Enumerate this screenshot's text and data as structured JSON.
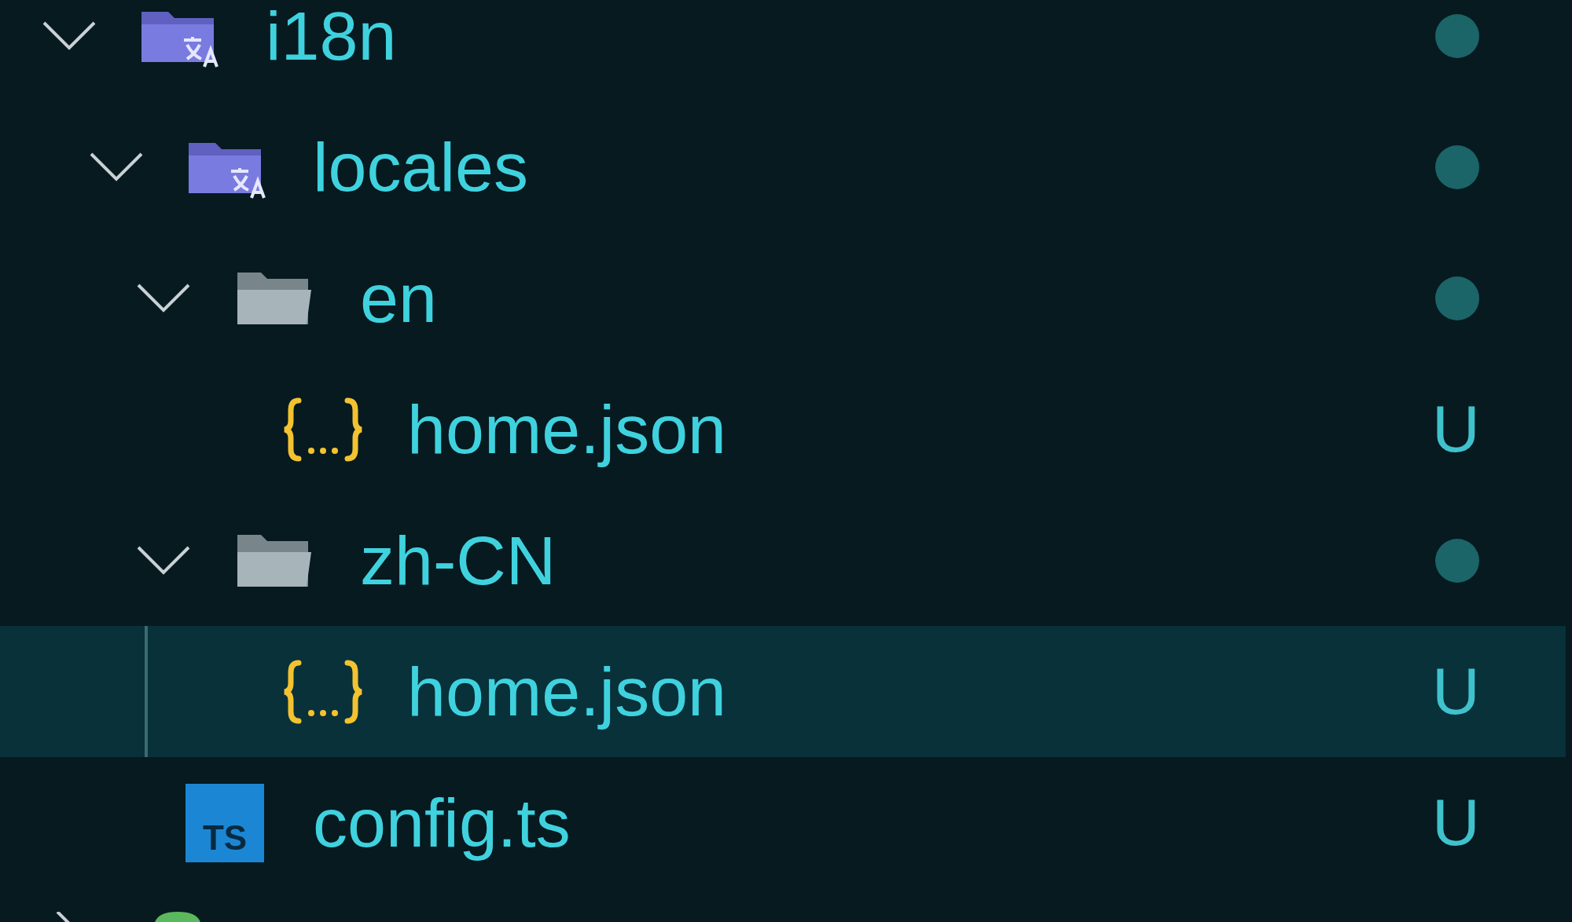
{
  "tree": [
    {
      "name": "i18n",
      "kind": "i18n-folder",
      "expanded": true,
      "selected": false,
      "badge": {
        "kind": "dot"
      },
      "children": [
        {
          "name": "locales",
          "kind": "i18n-folder",
          "expanded": true,
          "selected": false,
          "badge": {
            "kind": "dot"
          },
          "children": [
            {
              "name": "en",
              "kind": "folder",
              "expanded": true,
              "selected": false,
              "badge": {
                "kind": "dot"
              },
              "children": [
                {
                  "name": "home.json",
                  "kind": "json",
                  "selected": false,
                  "badge": {
                    "kind": "text",
                    "text": "U"
                  }
                }
              ]
            },
            {
              "name": "zh-CN",
              "kind": "folder",
              "expanded": true,
              "selected": false,
              "badge": {
                "kind": "dot"
              },
              "children": [
                {
                  "name": "home.json",
                  "kind": "json",
                  "selected": true,
                  "badge": {
                    "kind": "text",
                    "text": "U"
                  }
                }
              ]
            }
          ]
        },
        {
          "name": "config.ts",
          "kind": "ts",
          "icon_text": "TS",
          "selected": false,
          "badge": {
            "kind": "text",
            "text": "U"
          }
        }
      ]
    },
    {
      "kind": "green-file",
      "expanded": false,
      "selected": false
    }
  ]
}
